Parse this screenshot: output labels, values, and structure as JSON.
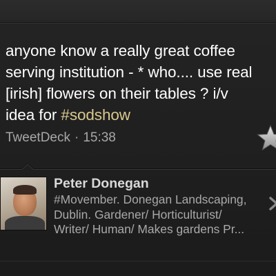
{
  "tweet": {
    "lines": [
      "anyone know a really great coffee",
      "serving institution - * who.... use real",
      "[irish] flowers on their tables ? i/v",
      "idea for "
    ],
    "hashtag": "#sodshow",
    "source": "TweetDeck",
    "separator": "·",
    "time": "15:38",
    "favorite_icon": "star-icon"
  },
  "profile": {
    "name": "Peter Donegan",
    "bio_lines": [
      "#Movember. Donegan Landscaping,",
      "Dublin. Gardener/ Horticulturist/",
      "Writer/ Human/ Makes gardens Pr..."
    ],
    "avatar_icon": "avatar",
    "disclosure_icon": "chevron-right-icon"
  },
  "colors": {
    "background": "#222222",
    "text": "#ffffff",
    "hashtag": "#d8c98f",
    "meta": "#a8a8a8"
  }
}
